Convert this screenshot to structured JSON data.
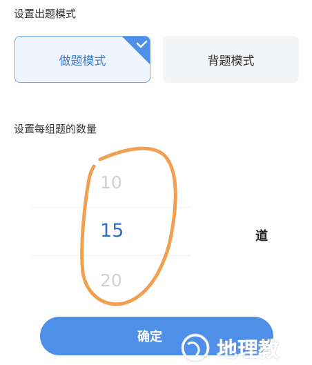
{
  "mode_section": {
    "label": "设置出题模式",
    "options": [
      {
        "label": "做题模式",
        "selected": true
      },
      {
        "label": "背题模式",
        "selected": false
      }
    ]
  },
  "count_section": {
    "label": "设置每组题的数量",
    "picker": {
      "items": [
        "10",
        "15",
        "20"
      ],
      "selected": "15"
    },
    "unit": "道"
  },
  "confirm_label": "确定",
  "watermark": {
    "text": "地理教"
  },
  "colors": {
    "accent": "#4e8fe8",
    "selected_text": "#2f6fc7",
    "annotation": "#f0a050"
  }
}
